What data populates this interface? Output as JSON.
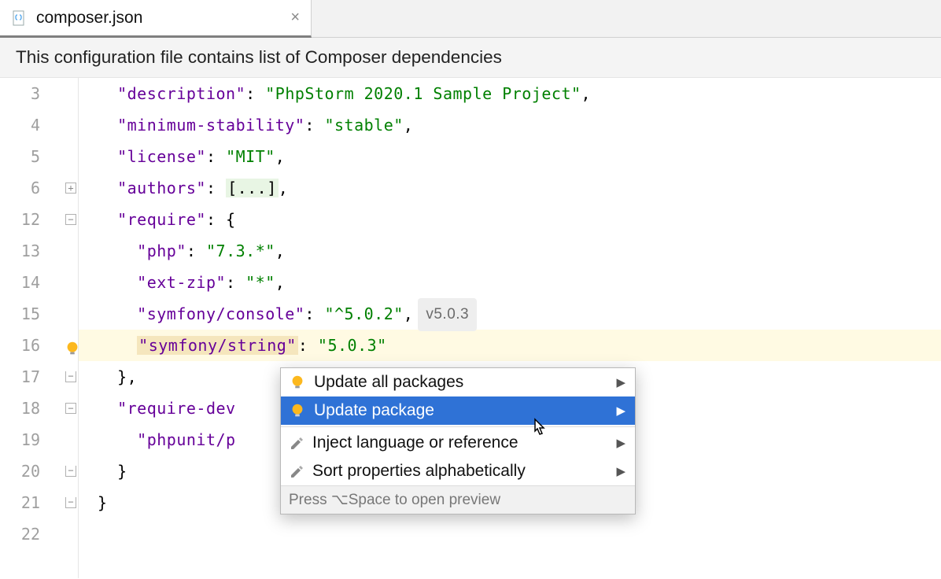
{
  "tab": {
    "filename": "composer.json"
  },
  "banner": "This configuration file contains list of Composer dependencies",
  "gutter_lines": [
    "3",
    "4",
    "5",
    "6",
    "12",
    "13",
    "14",
    "15",
    "16",
    "17",
    "18",
    "19",
    "20",
    "21",
    "22"
  ],
  "code": {
    "desc_key": "\"description\"",
    "desc_val": "\"PhpStorm 2020.1 Sample Project\"",
    "minstab_key": "\"minimum-stability\"",
    "minstab_val": "\"stable\"",
    "license_key": "\"license\"",
    "license_val": "\"MIT\"",
    "authors_key": "\"authors\"",
    "authors_val": "[...]",
    "require_key": "\"require\"",
    "php_key": "\"php\"",
    "php_val": "\"7.3.*\"",
    "extzip_key": "\"ext-zip\"",
    "extzip_val": "\"*\"",
    "symcon_key": "\"symfony/console\"",
    "symcon_val": "\"^5.0.2\"",
    "symcon_badge": "v5.0.3",
    "symstr_key": "\"symfony/string\"",
    "symstr_val": "\"5.0.3\"",
    "reqdev_key": "\"require-dev",
    "phpunit_key": "\"phpunit/p"
  },
  "menu": {
    "update_all": "Update all packages",
    "update_pkg": "Update package",
    "inject": "Inject language or reference",
    "sort": "Sort properties alphabetically",
    "footer": "Press ⌥Space to open preview"
  }
}
